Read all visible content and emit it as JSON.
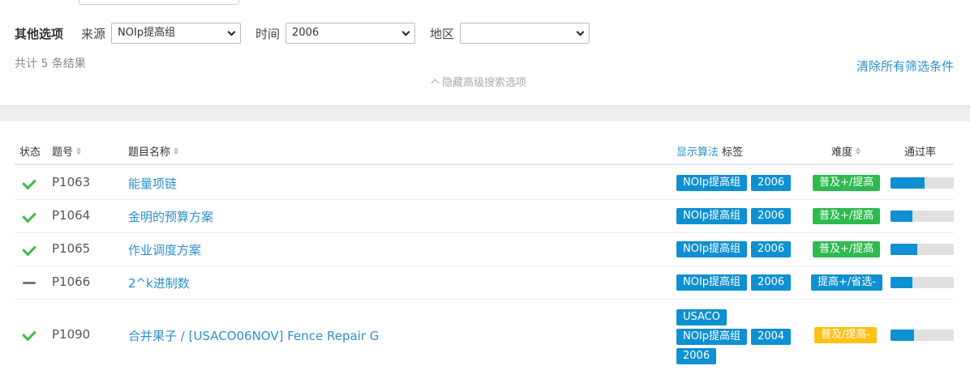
{
  "filters": {
    "title": "其他选项",
    "source_label": "来源",
    "source_value": "NOIp提高组",
    "time_label": "时间",
    "time_value": "2006",
    "region_label": "地区",
    "region_value": ""
  },
  "results": {
    "count_text": "共计 5 条结果",
    "clear_label": "清除所有筛选条件",
    "hide_advanced_label": "隐藏高级搜索选项"
  },
  "table": {
    "headers": {
      "status": "状态",
      "id": "题号",
      "name": "题目名称",
      "show_algo": "显示算法",
      "tags": "标签",
      "difficulty": "难度",
      "pass_rate": "通过率"
    },
    "rows": [
      {
        "status": "solved",
        "id": "P1063",
        "name": "能量项链",
        "tags": [
          "NOIp提高组",
          "2006"
        ],
        "difficulty": "普及+/提高",
        "difficulty_color": "#2dba4e",
        "pass_rate": 0.54
      },
      {
        "status": "solved",
        "id": "P1064",
        "name": "金明的预算方案",
        "tags": [
          "NOIp提高组",
          "2006"
        ],
        "difficulty": "普及+/提高",
        "difficulty_color": "#2dba4e",
        "pass_rate": 0.34
      },
      {
        "status": "solved",
        "id": "P1065",
        "name": "作业调度方案",
        "tags": [
          "NOIp提高组",
          "2006"
        ],
        "difficulty": "普及+/提高",
        "difficulty_color": "#2dba4e",
        "pass_rate": 0.42
      },
      {
        "status": "attempted",
        "id": "P1066",
        "name": "2^k进制数",
        "tags": [
          "NOIp提高组",
          "2006"
        ],
        "difficulty": "提高+/省选-",
        "difficulty_color": "#0e90d2",
        "pass_rate": 0.34
      },
      {
        "status": "solved",
        "id": "P1090",
        "name": "合并果子 / [USACO06NOV] Fence Repair G",
        "tags": [
          "USACO",
          "NOIp提高组",
          "2004",
          "2006"
        ],
        "difficulty": "普及/提高-",
        "difficulty_color": "#ffc116",
        "pass_rate": 0.37
      }
    ]
  },
  "colors": {
    "accent": "#2b91c9",
    "tag_bg": "#0e90d2",
    "check": "#3dbb4b"
  }
}
